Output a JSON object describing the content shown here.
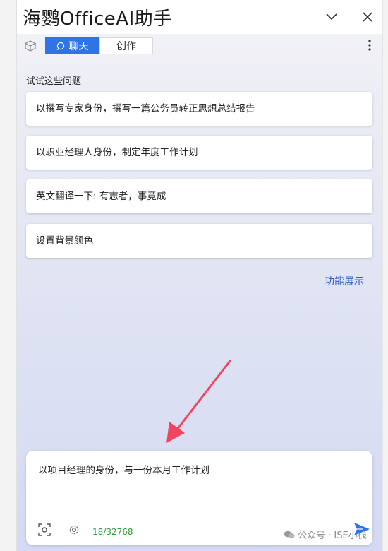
{
  "app": {
    "title": "海鹦OfficeAI助手"
  },
  "titlebar": {
    "collapse_icon": "chevron-down-icon",
    "close_icon": "close-icon"
  },
  "toolbar": {
    "cube_icon": "cube-icon",
    "tabs": [
      {
        "label": "聊天",
        "active": true,
        "icon": "chat-bubble-icon"
      },
      {
        "label": "创作",
        "active": false
      }
    ],
    "more_icon": "more-vertical-icon"
  },
  "suggestions": {
    "title": "试试这些问题",
    "items": [
      "以撰写专家身份，撰写一篇公务员转正思想总结报告",
      "以职业经理人身份，制定年度工作计划",
      "英文翻译一下: 有志者，事竟成",
      "设置背景颜色"
    ]
  },
  "feature_link": "功能展示",
  "input": {
    "value": "以项目经理的身份，与一份本月工作计划",
    "char_count": "18/32768",
    "screenshot_icon": "screenshot-icon",
    "settings_icon": "gear-icon",
    "send_icon": "send-icon"
  },
  "watermark": {
    "text": "公众号 · ISE小栈"
  },
  "colors": {
    "accent": "#2f74e6",
    "link": "#2f5fc9",
    "counter": "#2e9a3a",
    "arrow": "#f0455f"
  }
}
